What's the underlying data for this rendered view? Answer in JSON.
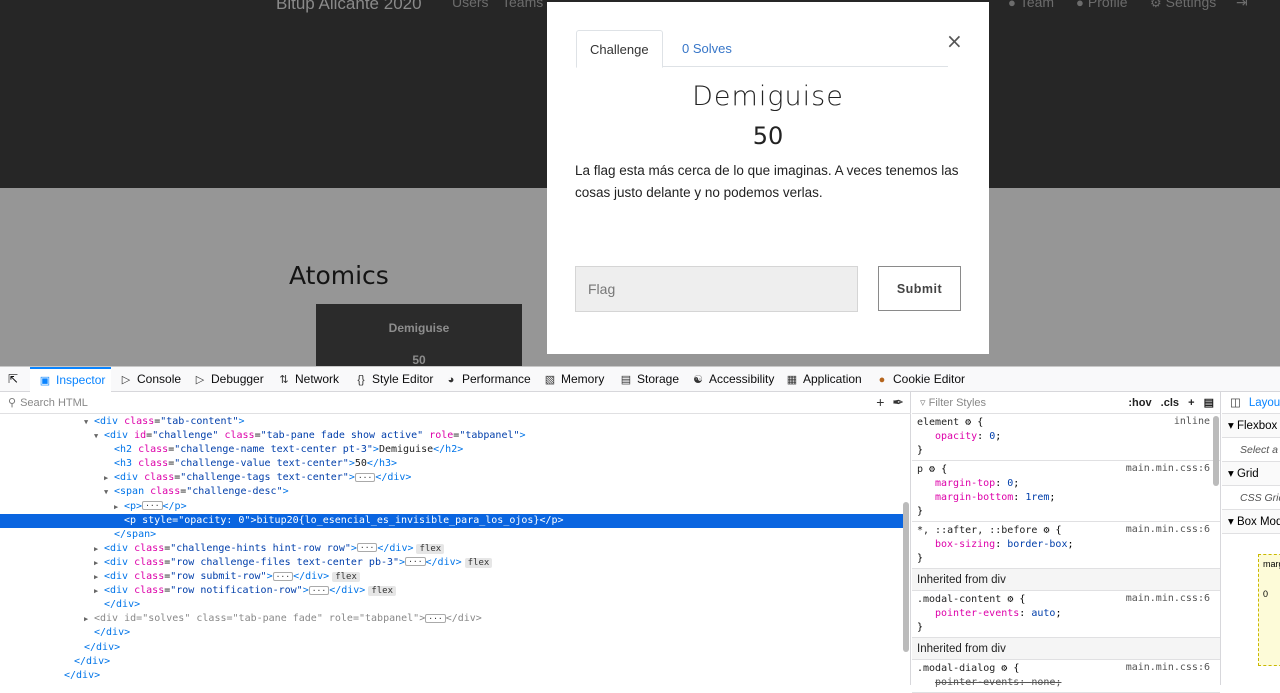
{
  "page": {
    "brand": "Bitup Alicante 2020",
    "nav_left": [
      "Users",
      "Teams"
    ],
    "nav_right": [
      {
        "icon": "team-icon",
        "label": "Team"
      },
      {
        "icon": "profile-icon",
        "label": "Profile"
      },
      {
        "icon": "settings-icon",
        "label": "Settings"
      }
    ],
    "section_title": "Atomics",
    "card": {
      "name": "Demiguise",
      "value": "50"
    }
  },
  "modal": {
    "close_glyph": "×",
    "tabs": [
      "Challenge",
      "0 Solves"
    ],
    "name": "Demiguise",
    "value": "50",
    "description": "La flag esta más cerca de lo que imaginas. A veces tenemos las cosas justo delante y no podemos verlas.",
    "flag_placeholder": "Flag",
    "submit_label": "Submit"
  },
  "devtools": {
    "tabs": [
      "Inspector",
      "Console",
      "Debugger",
      "Network",
      "Style Editor",
      "Performance",
      "Memory",
      "Storage",
      "Accessibility",
      "Application",
      "Cookie Editor"
    ],
    "search_placeholder": "Search HTML",
    "filter_placeholder": "Filter Styles",
    "rules_toggles": [
      ":hov",
      ".cls"
    ],
    "rules": [
      {
        "selector": "element",
        "source": "inline",
        "props": [
          {
            "name": "opacity",
            "value": "0"
          }
        ]
      },
      {
        "selector": "p",
        "source": "main.min.css:6",
        "props": [
          {
            "name": "margin-top",
            "value": "0"
          },
          {
            "name": "margin-bottom",
            "value": "1rem"
          }
        ]
      },
      {
        "selector": "*, ::after, ::before",
        "source": "main.min.css:6",
        "props": [
          {
            "name": "box-sizing",
            "value": "border-box"
          }
        ]
      }
    ],
    "inherited_label": "Inherited from div",
    "inherited_rules": [
      {
        "selector": ".modal-content",
        "source": "main.min.css:6",
        "props": [
          {
            "name": "pointer-events",
            "value": "auto"
          }
        ]
      },
      {
        "selector": ".modal-dialog",
        "source": "main.min.css:6",
        "props": [
          {
            "name": "pointer-events",
            "value": "none"
          }
        ]
      }
    ],
    "layout": {
      "tab": "Layout",
      "flexbox": "Flexbox",
      "flexbox_hint": "Select a Flex container or item to continue.",
      "grid": "Grid",
      "grid_hint": "CSS Grid is not in use on this page",
      "box_model": "Box Model",
      "box_label": "margin",
      "box_value": "0"
    }
  }
}
